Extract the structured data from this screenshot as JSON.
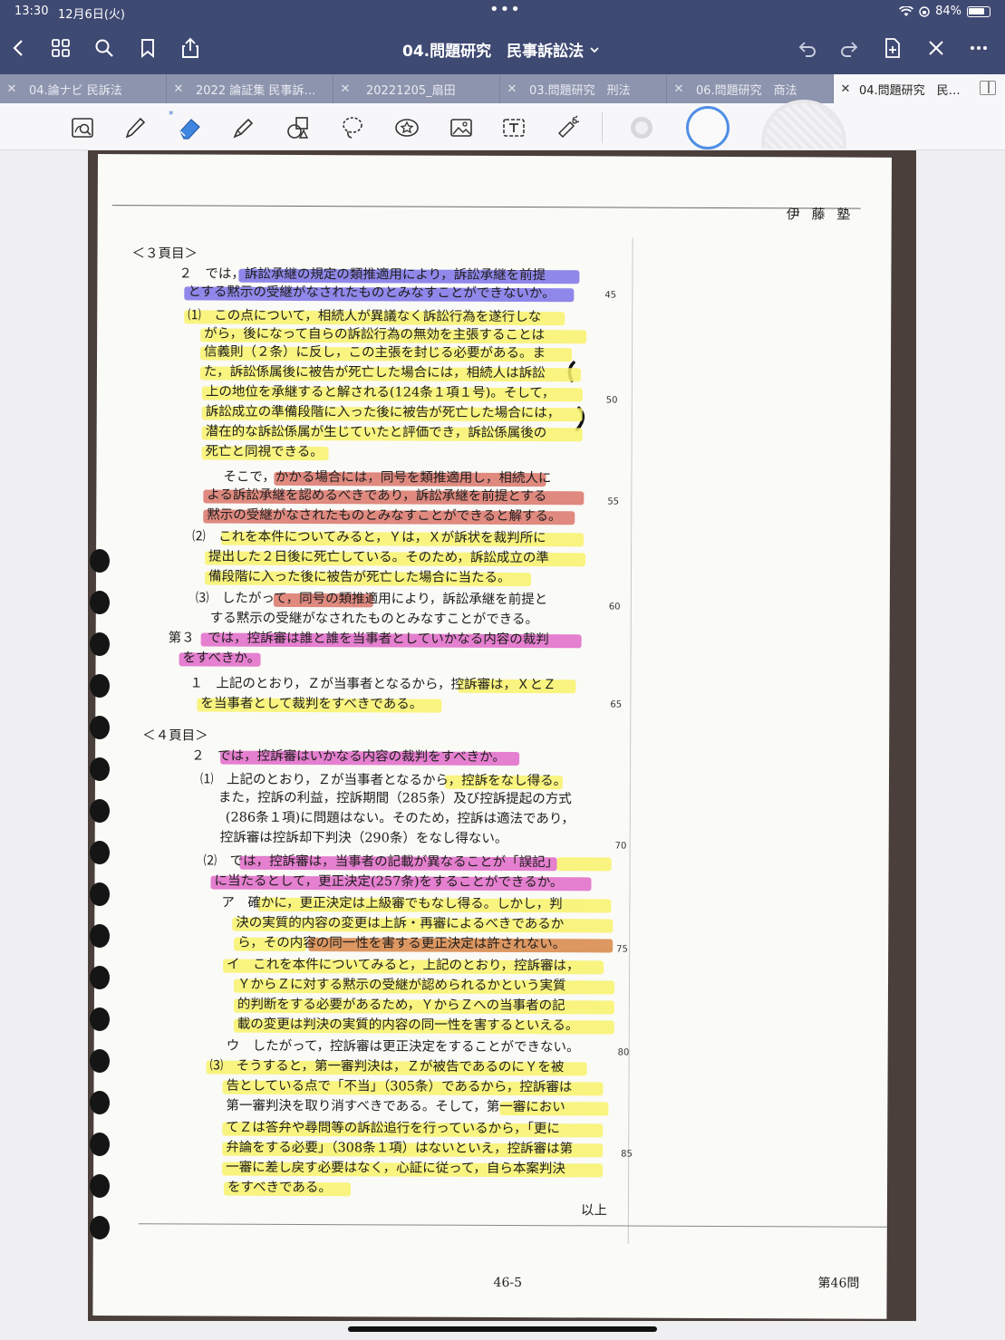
{
  "status_bar": {
    "time": "13:30",
    "date": "12月6日(火)",
    "battery": "84%",
    "battery_level": 0.84
  },
  "nav": {
    "title": "04.問題研究　民事訴訟法"
  },
  "tabs": [
    {
      "label": "04.論ナビ 民訴法"
    },
    {
      "label": "2022 論証集 民事訴…"
    },
    {
      "label": "20221205_扇田"
    },
    {
      "label": "03.問題研究　刑法"
    },
    {
      "label": "06.問題研究　商法"
    },
    {
      "label": "04.問題研究　民…",
      "active": true
    }
  ],
  "toolbar": {
    "tools": [
      "zoom-box-icon",
      "pen-icon",
      "eraser-icon",
      "highlighter-icon",
      "shapes-icon",
      "lasso-icon",
      "sticker-icon",
      "image-icon",
      "text-icon",
      "laser-icon"
    ],
    "bluetooth_mark": "*"
  },
  "page": {
    "header_name": "伊 藤 塾",
    "footer_page": "46-5",
    "footer_question": "第46問",
    "line_numbers": [
      "45",
      "50",
      "55",
      "60",
      "65",
      "70",
      "75",
      "80",
      "85"
    ],
    "lines": [
      "＜３頁目＞",
      "２　では，訴訟承継の規定の類推適用により，訴訟承継を前提",
      "とする黙示の受継がなされたものとみなすことができないか。",
      "⑴　この点について，相続人が異議なく訴訟行為を遂行しな",
      "がら，後になって自らの訴訟行為の無効を主張することは",
      "信義則（２条）に反し，この主張を封じる必要がある。ま",
      "た，訴訟係属後に被告が死亡した場合には，相続人は訴訟",
      "上の地位を承継すると解される(124条１項１号)。そして，",
      "訴訟成立の準備段階に入った後に被告が死亡した場合には，",
      "潜在的な訴訟係属が生じていたと評価でき，訴訟係属後の",
      "死亡と同視できる。",
      "そこで，かかる場合には，同号を類推適用し，相続人に",
      "よる訴訟承継を認めるべきであり，訴訟承継を前提とする",
      "黙示の受継がなされたものとみなすことができると解する。",
      "⑵　これを本件についてみると，Ｙは，Ｘが訴状を裁判所に",
      "提出した２日後に死亡している。そのため，訴訟成立の準",
      "備段階に入った後に被告が死亡した場合に当たる。",
      "⑶　したがって，同号の類推適用により，訴訟承継を前提と",
      "する黙示の受継がなされたものとみなすことができる。",
      "第３　では，控訴審は誰と誰を当事者としていかなる内容の裁判",
      "をすべきか。",
      "１　上記のとおり，Ｚが当事者となるから，控訴審は，ＸとＺ",
      "を当事者として裁判をすべきである。",
      "＜４頁目＞",
      "２　では，控訴審はいかなる内容の裁判をすべきか。",
      "⑴　上記のとおり，Ｚが当事者となるから，控訴をなし得る。",
      "また，控訴の利益，控訴期間（285条）及び控訴提起の方式",
      "(286条１項)に問題はない。そのため，控訴は適法であり，",
      "控訴審は控訴却下判決（290条）をなし得ない。",
      "⑵　では，控訴審は，当事者の記載が異なることが「誤記」",
      "に当たるとして，更正決定(257条)をすることができるか。",
      "ア　確かに，更正決定は上級審でもなし得る。しかし，判",
      "決の実質的内容の変更は上訴・再審によるべきであるか",
      "ら，その内容の同一性を害する更正決定は許されない。",
      "イ　これを本件についてみると，上記のとおり，控訴審は，",
      "ＹからＺに対する黙示の受継が認められるかという実質",
      "的判断をする必要があるため，ＹからＺへの当事者の記",
      "載の変更は判決の実質的内容の同一性を害するといえる。",
      "ウ　したがって，控訴審は更正決定をすることができない。",
      "⑶　そうすると，第一審判決は，Ｚが被告であるのにＹを被",
      "告としている点で「不当」（305条）であるから，控訴審は",
      "第一審判決を取り消すべきである。そして，第一審におい",
      "てＺは答弁や尋問等の訴訟追行を行っているから，「更に",
      "弁論をする必要」（308条１項）はないといえ，控訴審は第",
      "一審に差し戻す必要はなく，心証に従って，自ら本案判決",
      "をすべきである。",
      "以上"
    ]
  }
}
